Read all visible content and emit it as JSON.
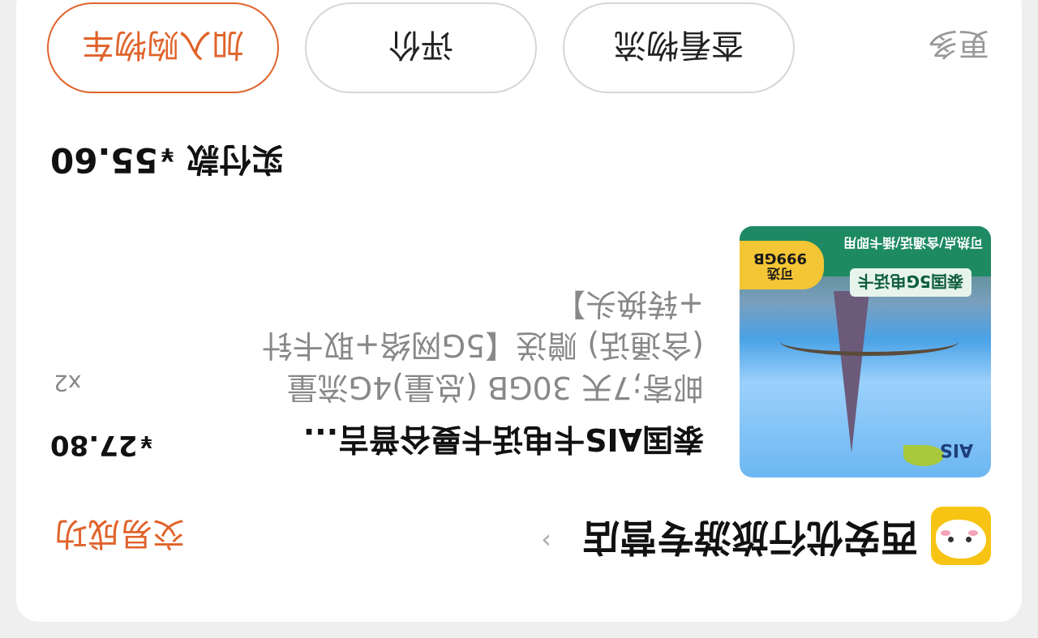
{
  "shop": {
    "name": "西安优行旅游专营店",
    "status": "交易成功",
    "logo_icon": "chicken-mascot-icon"
  },
  "product": {
    "title": "泰国AIS卡电话卡曼谷普吉...",
    "description": "邮寄;7天 30GB (总量)4G流量 (含通话) 赠送【5G网络+取卡针+转换头】",
    "price": "27.80",
    "currency": "¥",
    "quantity": "x2",
    "image": {
      "brand": "AIS",
      "banner_title": "泰国5G电话卡",
      "banner_sub": "可热点/含通话/插卡即用",
      "badge_line1": "可选",
      "badge_line2": "999GB"
    }
  },
  "payment": {
    "label": "实付款",
    "currency": "¥",
    "amount": "55.60"
  },
  "actions": {
    "more": "更多",
    "logistics": "查看物流",
    "review": "评价",
    "add_to_cart": "加入购物车"
  },
  "colors": {
    "accent": "#e0632b",
    "logo_bg": "#f8c413"
  }
}
